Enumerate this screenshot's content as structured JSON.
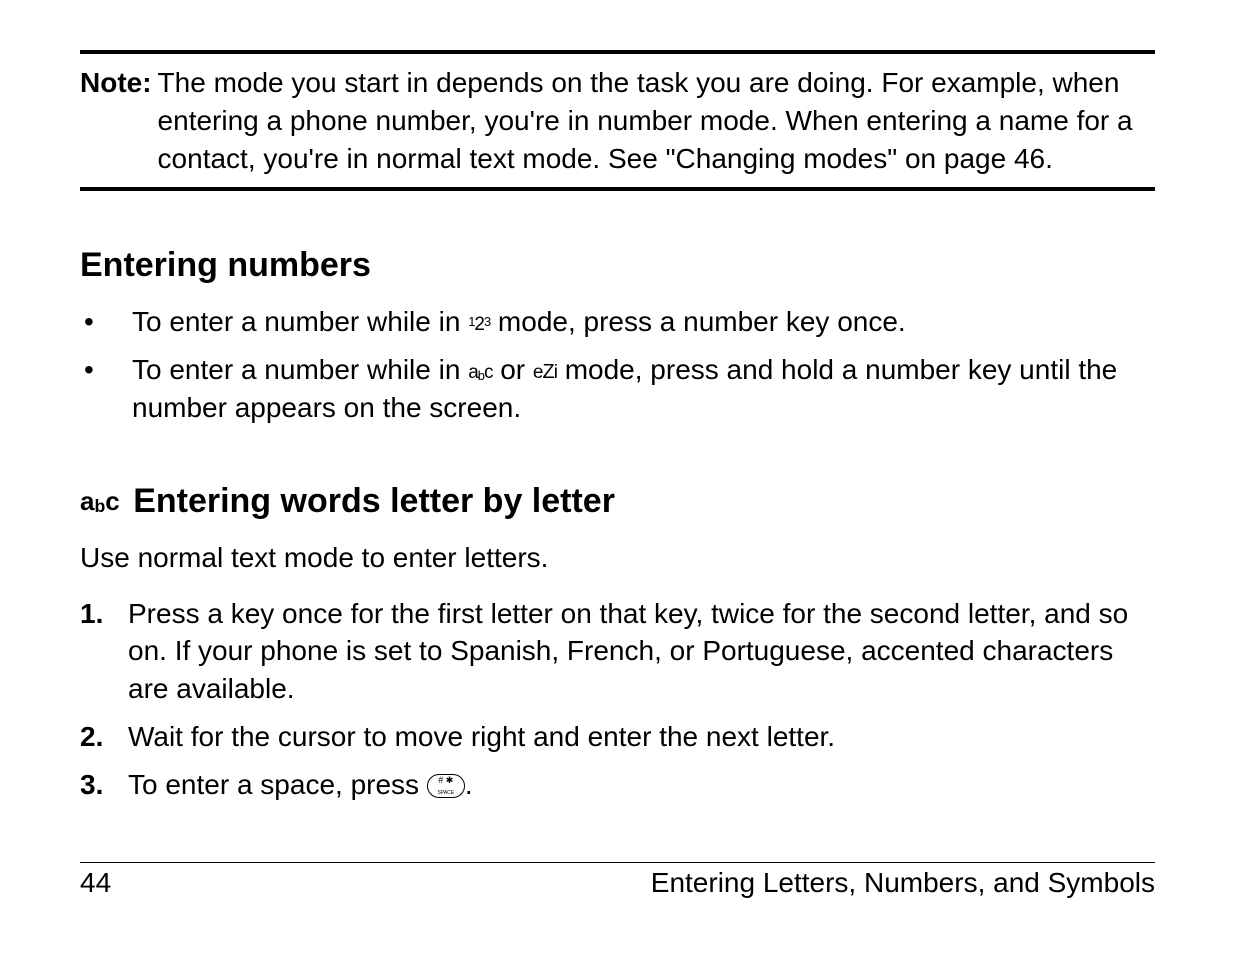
{
  "note": {
    "label": "Note:",
    "text": "The mode you start in depends on the task you are doing. For example, when entering a phone number, you're in number mode. When entering a name for a contact, you're in normal text mode. See \"Changing modes\" on page 46."
  },
  "section1": {
    "heading": "Entering numbers",
    "bullets": [
      {
        "pre": "To enter a number while in ",
        "icon": "123",
        "post": " mode, press a number key once."
      },
      {
        "pre": "To enter a number while in ",
        "icon": "abc",
        "mid": " or ",
        "icon2": "ezi",
        "post": " mode, press and hold a number key until the number appears on the screen."
      }
    ]
  },
  "section2": {
    "icon": "abc",
    "heading": "Entering words letter by letter",
    "intro": "Use normal text mode to enter letters.",
    "steps": [
      {
        "num": "1.",
        "text": "Press a key once for the first letter on that key, twice for the second letter, and so on. If your phone is set to Spanish, French, or Portuguese, accented characters are available."
      },
      {
        "num": "2.",
        "text": "Wait for the cursor to move right and enter the next letter."
      },
      {
        "num": "3.",
        "pre": "To enter a space, press ",
        "icon": "space-key",
        "post": "."
      }
    ]
  },
  "footer": {
    "page": "44",
    "title": "Entering Letters, Numbers, and Symbols"
  }
}
